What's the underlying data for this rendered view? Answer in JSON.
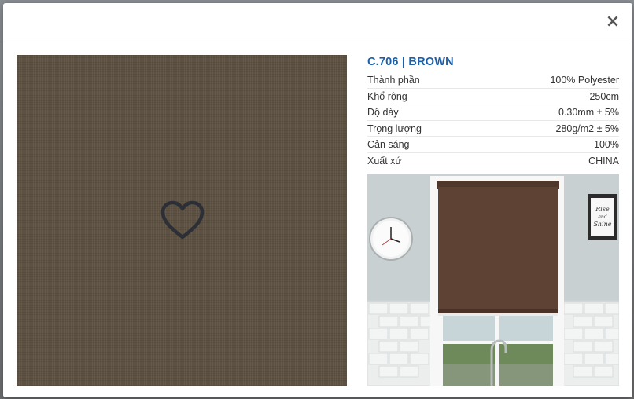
{
  "modal": {
    "close_label": "×"
  },
  "product": {
    "title": "C.706 | BROWN",
    "swatch_color": "#5d5142",
    "specs": [
      {
        "label": "Thành phần",
        "value": "100% Polyester"
      },
      {
        "label": "Khổ rộng",
        "value": "250cm"
      },
      {
        "label": "Độ dày",
        "value": "0.30mm ± 5%"
      },
      {
        "label": "Trọng lượng",
        "value": "280g/m2 ± 5%"
      },
      {
        "label": "Cản sáng",
        "value": "100%"
      },
      {
        "label": "Xuất xứ",
        "value": "CHINA"
      }
    ]
  },
  "preview": {
    "frame_text_line1": "Rise",
    "frame_text_line2": "and",
    "frame_text_line3": "Shine",
    "blind_color": "#5e4335"
  }
}
